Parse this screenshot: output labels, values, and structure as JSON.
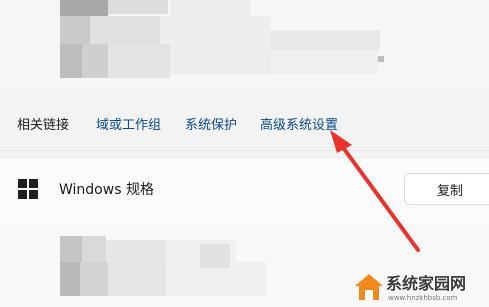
{
  "related_links": {
    "label": "相关链接",
    "links": [
      "域或工作组",
      "系统保护",
      "高级系统设置"
    ]
  },
  "windows_spec": {
    "title": "Windows 规格",
    "copy_label": "复制"
  },
  "watermark": {
    "text": "系统家园网",
    "sub": "www.hnzkhbsb.com"
  },
  "colors": {
    "link": "#0a4a8c",
    "arrow": "#e8322b"
  }
}
